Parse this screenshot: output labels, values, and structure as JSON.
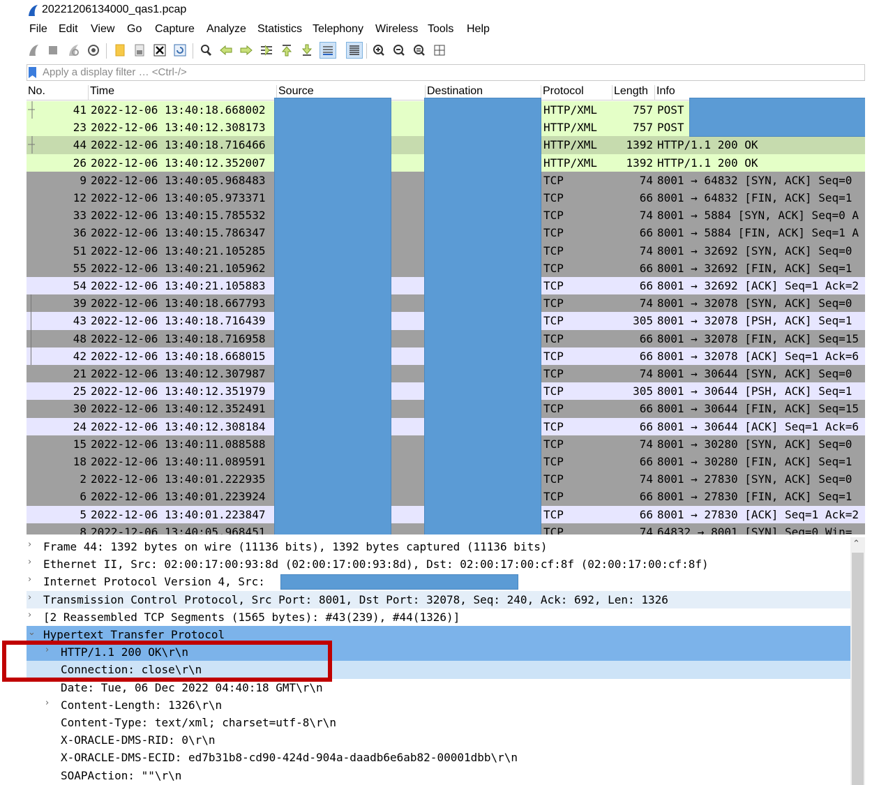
{
  "window": {
    "title": "20221206134000_qas1.pcap"
  },
  "menu": [
    "File",
    "Edit",
    "View",
    "Go",
    "Capture",
    "Analyze",
    "Statistics",
    "Telephony",
    "Wireless",
    "Tools",
    "Help"
  ],
  "toolbar": {
    "icons": [
      "shark-fin-start-icon",
      "stop-capture-icon",
      "restart-capture-icon",
      "capture-options-icon",
      "open-file-icon",
      "save-file-icon",
      "close-file-icon",
      "reload-icon",
      "find-packet-icon",
      "go-back-icon",
      "go-forward-icon",
      "go-to-packet-icon",
      "first-packet-icon",
      "last-packet-icon",
      "autoscroll-icon",
      "colorize-icon",
      "zoom-in-icon",
      "zoom-out-icon",
      "normal-size-icon",
      "resize-columns-icon"
    ]
  },
  "filter": {
    "placeholder": "Apply a display filter … <Ctrl-/>"
  },
  "packet_list": {
    "columns": [
      "No.",
      "Time",
      "Source",
      "Destination",
      "Protocol",
      "Length",
      "Info"
    ],
    "rows": [
      {
        "no": "41",
        "time": "2022-12-06 13:40:18.668002",
        "protocol": "HTTP/XML",
        "length": "757",
        "info": "POST",
        "bg": "#e4ffc7"
      },
      {
        "no": "23",
        "time": "2022-12-06 13:40:12.308173",
        "protocol": "HTTP/XML",
        "length": "757",
        "info": "POST",
        "bg": "#e4ffc7"
      },
      {
        "no": "44",
        "time": "2022-12-06 13:40:18.716466",
        "protocol": "HTTP/XML",
        "length": "1392",
        "info": "HTTP/1.1 200 OK",
        "bg": "#c6dbae"
      },
      {
        "no": "26",
        "time": "2022-12-06 13:40:12.352007",
        "protocol": "HTTP/XML",
        "length": "1392",
        "info": "HTTP/1.1 200 OK",
        "bg": "#e4ffc7"
      },
      {
        "no": "9",
        "time": "2022-12-06 13:40:05.968483",
        "protocol": "TCP",
        "length": "74",
        "info": "8001 → 64832 [SYN, ACK] Seq=0",
        "bg": "#a0a0a0"
      },
      {
        "no": "12",
        "time": "2022-12-06 13:40:05.973371",
        "protocol": "TCP",
        "length": "66",
        "info": "8001 → 64832 [FIN, ACK] Seq=1",
        "bg": "#a0a0a0"
      },
      {
        "no": "33",
        "time": "2022-12-06 13:40:15.785532",
        "protocol": "TCP",
        "length": "74",
        "info": "8001 → 5884 [SYN, ACK] Seq=0 A",
        "bg": "#a0a0a0"
      },
      {
        "no": "36",
        "time": "2022-12-06 13:40:15.786347",
        "protocol": "TCP",
        "length": "66",
        "info": "8001 → 5884 [FIN, ACK] Seq=1 A",
        "bg": "#a0a0a0"
      },
      {
        "no": "51",
        "time": "2022-12-06 13:40:21.105285",
        "protocol": "TCP",
        "length": "74",
        "info": "8001 → 32692 [SYN, ACK] Seq=0",
        "bg": "#a0a0a0"
      },
      {
        "no": "55",
        "time": "2022-12-06 13:40:21.105962",
        "protocol": "TCP",
        "length": "66",
        "info": "8001 → 32692 [FIN, ACK] Seq=1",
        "bg": "#a0a0a0"
      },
      {
        "no": "54",
        "time": "2022-12-06 13:40:21.105883",
        "protocol": "TCP",
        "length": "66",
        "info": "8001 → 32692 [ACK] Seq=1 Ack=2",
        "bg": "#e7e6ff"
      },
      {
        "no": "39",
        "time": "2022-12-06 13:40:18.667793",
        "protocol": "TCP",
        "length": "74",
        "info": "8001 → 32078 [SYN, ACK] Seq=0",
        "bg": "#a0a0a0"
      },
      {
        "no": "43",
        "time": "2022-12-06 13:40:18.716439",
        "protocol": "TCP",
        "length": "305",
        "info": "8001 → 32078 [PSH, ACK] Seq=1",
        "bg": "#e7e6ff"
      },
      {
        "no": "48",
        "time": "2022-12-06 13:40:18.716958",
        "protocol": "TCP",
        "length": "66",
        "info": "8001 → 32078 [FIN, ACK] Seq=15",
        "bg": "#a0a0a0"
      },
      {
        "no": "42",
        "time": "2022-12-06 13:40:18.668015",
        "protocol": "TCP",
        "length": "66",
        "info": "8001 → 32078 [ACK] Seq=1 Ack=6",
        "bg": "#e7e6ff"
      },
      {
        "no": "21",
        "time": "2022-12-06 13:40:12.307987",
        "protocol": "TCP",
        "length": "74",
        "info": "8001 → 30644 [SYN, ACK] Seq=0",
        "bg": "#a0a0a0"
      },
      {
        "no": "25",
        "time": "2022-12-06 13:40:12.351979",
        "protocol": "TCP",
        "length": "305",
        "info": "8001 → 30644 [PSH, ACK] Seq=1",
        "bg": "#e7e6ff"
      },
      {
        "no": "30",
        "time": "2022-12-06 13:40:12.352491",
        "protocol": "TCP",
        "length": "66",
        "info": "8001 → 30644 [FIN, ACK] Seq=15",
        "bg": "#a0a0a0"
      },
      {
        "no": "24",
        "time": "2022-12-06 13:40:12.308184",
        "protocol": "TCP",
        "length": "66",
        "info": "8001 → 30644 [ACK] Seq=1 Ack=6",
        "bg": "#e7e6ff"
      },
      {
        "no": "15",
        "time": "2022-12-06 13:40:11.088588",
        "protocol": "TCP",
        "length": "74",
        "info": "8001 → 30280 [SYN, ACK] Seq=0",
        "bg": "#a0a0a0"
      },
      {
        "no": "18",
        "time": "2022-12-06 13:40:11.089591",
        "protocol": "TCP",
        "length": "66",
        "info": "8001 → 30280 [FIN, ACK] Seq=1",
        "bg": "#a0a0a0"
      },
      {
        "no": "2",
        "time": "2022-12-06 13:40:01.222935",
        "protocol": "TCP",
        "length": "74",
        "info": "8001 → 27830 [SYN, ACK] Seq=0",
        "bg": "#a0a0a0"
      },
      {
        "no": "6",
        "time": "2022-12-06 13:40:01.223924",
        "protocol": "TCP",
        "length": "66",
        "info": "8001 → 27830 [FIN, ACK] Seq=1",
        "bg": "#a0a0a0"
      },
      {
        "no": "5",
        "time": "2022-12-06 13:40:01.223847",
        "protocol": "TCP",
        "length": "66",
        "info": "8001 → 27830 [ACK] Seq=1 Ack=2",
        "bg": "#e7e6ff"
      },
      {
        "no": "8",
        "time": "2022-12-06 13:40:05.968451",
        "protocol": "TCP",
        "length": "74",
        "info": "64832 → 8001 [SYN] Seq=0 Win=",
        "bg": "#a0a0a0"
      }
    ]
  },
  "details": {
    "rows": [
      {
        "indent": 0,
        "arrow": "›",
        "text": "Frame 44: 1392 bytes on wire (11136 bits), 1392 bytes captured (11136 bits)",
        "bg": "#ffffff"
      },
      {
        "indent": 0,
        "arrow": "›",
        "text": "Ethernet II, Src: 02:00:17:00:93:8d (02:00:17:00:93:8d), Dst: 02:00:17:00:cf:8f (02:00:17:00:cf:8f)",
        "bg": "#ffffff"
      },
      {
        "indent": 0,
        "arrow": "›",
        "text": "Internet Protocol Version 4, Src:",
        "bg": "#ffffff"
      },
      {
        "indent": 0,
        "arrow": "›",
        "text": "Transmission Control Protocol, Src Port: 8001, Dst Port: 32078, Seq: 240, Ack: 692, Len: 1326",
        "bg": "#e4eef8"
      },
      {
        "indent": 0,
        "arrow": "›",
        "text": "[2 Reassembled TCP Segments (1565 bytes): #43(239), #44(1326)]",
        "bg": "#ffffff"
      },
      {
        "indent": 0,
        "arrow": "⌄",
        "text": "Hypertext Transfer Protocol",
        "bg": "#7cb3ea"
      },
      {
        "indent": 1,
        "arrow": "›",
        "text": "HTTP/1.1 200 OK\\r\\n",
        "bg": "#7cb3ea"
      },
      {
        "indent": 1,
        "arrow": "",
        "text": "Connection: close\\r\\n",
        "bg": "#cde3f7"
      },
      {
        "indent": 1,
        "arrow": "",
        "text": "Date: Tue, 06 Dec 2022 04:40:18 GMT\\r\\n",
        "bg": "#ffffff"
      },
      {
        "indent": 1,
        "arrow": "›",
        "text": "Content-Length: 1326\\r\\n",
        "bg": "#ffffff"
      },
      {
        "indent": 1,
        "arrow": "",
        "text": "Content-Type: text/xml; charset=utf-8\\r\\n",
        "bg": "#ffffff"
      },
      {
        "indent": 1,
        "arrow": "",
        "text": "X-ORACLE-DMS-RID: 0\\r\\n",
        "bg": "#ffffff"
      },
      {
        "indent": 1,
        "arrow": "",
        "text": "X-ORACLE-DMS-ECID: ed7b31b8-cd90-424d-904a-daadb6e6ab82-00001dbb\\r\\n",
        "bg": "#ffffff"
      },
      {
        "indent": 1,
        "arrow": "",
        "text": "SOAPAction: \"\"\\r\\n",
        "bg": "#ffffff"
      }
    ]
  },
  "colors": {
    "redaction": "#5b9bd5",
    "callout": "#c00000",
    "selection": "#7cb3ea"
  }
}
